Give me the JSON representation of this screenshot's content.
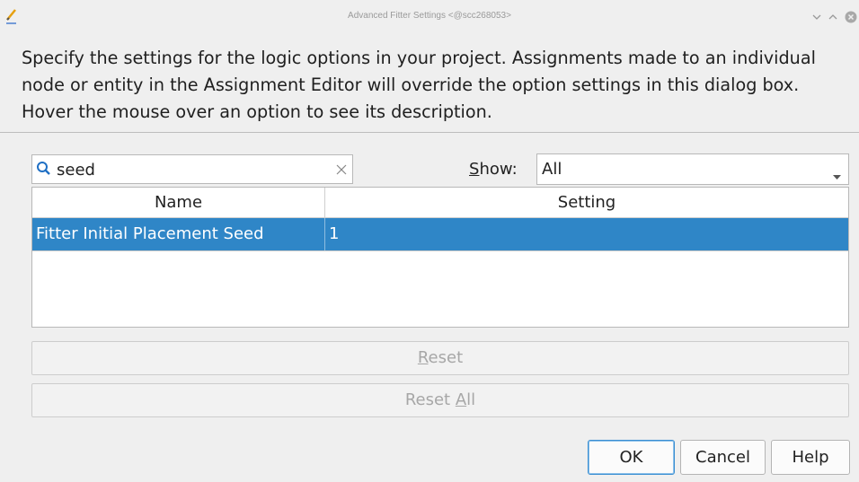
{
  "window": {
    "title": "Advanced Fitter Settings <@scc268053>",
    "icons": [
      "pen-icon",
      "minimize-icon",
      "maximize-icon",
      "close-icon"
    ]
  },
  "description": "Specify the settings for the logic options in your project.  Assignments made to an individual node or entity in the Assignment Editor will override the option settings in this dialog box. Hover the mouse over an option to see its description.",
  "filter": {
    "search_value": "seed",
    "show_label_mnemonic": "S",
    "show_label_rest": "how:",
    "show_selected": "All"
  },
  "table": {
    "columns": [
      "Name",
      "Setting"
    ],
    "rows": [
      {
        "name": "Fitter Initial Placement Seed",
        "setting": "1",
        "selected": true
      }
    ],
    "selection_color": "#2f86c7"
  },
  "actions": {
    "reset_mnemonic": "R",
    "reset_rest": "eset",
    "reset_all_prefix": "Reset ",
    "reset_all_mnemonic": "A",
    "reset_all_rest": "ll"
  },
  "buttons": {
    "ok": "OK",
    "cancel": "Cancel",
    "help": "Help"
  }
}
